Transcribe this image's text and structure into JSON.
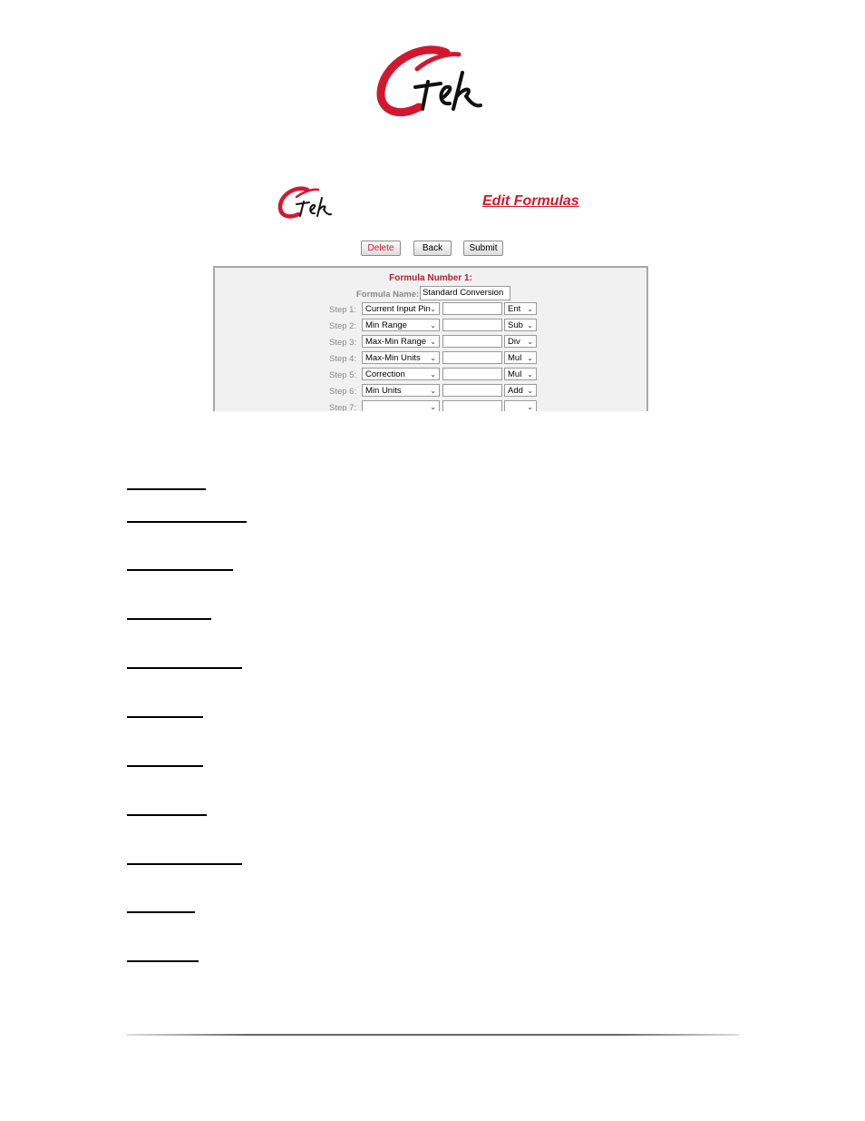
{
  "logo": {
    "text": "Ctek",
    "brand_color": "#d1182f"
  },
  "screenshot": {
    "title": "Edit Formulas",
    "buttons": {
      "delete": "Delete",
      "back": "Back",
      "submit": "Submit"
    },
    "form": {
      "heading": "Formula Number 1:",
      "name_label": "Formula Name:",
      "name_value": "Standard Conversion",
      "steps": [
        {
          "label": "Step 1:",
          "source": "Current Input Pin",
          "value": "",
          "op": "Ent"
        },
        {
          "label": "Step 2:",
          "source": "Min Range",
          "value": "",
          "op": "Sub"
        },
        {
          "label": "Step 3:",
          "source": "Max-Min Range",
          "value": "",
          "op": "Div"
        },
        {
          "label": "Step 4:",
          "source": "Max-Min Units",
          "value": "",
          "op": "Mul"
        },
        {
          "label": "Step 5:",
          "source": "Correction",
          "value": "",
          "op": "Mul"
        },
        {
          "label": "Step 6:",
          "source": "Min Units",
          "value": "",
          "op": "Add"
        },
        {
          "label": "Step 7:",
          "source": "",
          "value": "",
          "op": ""
        }
      ]
    }
  }
}
